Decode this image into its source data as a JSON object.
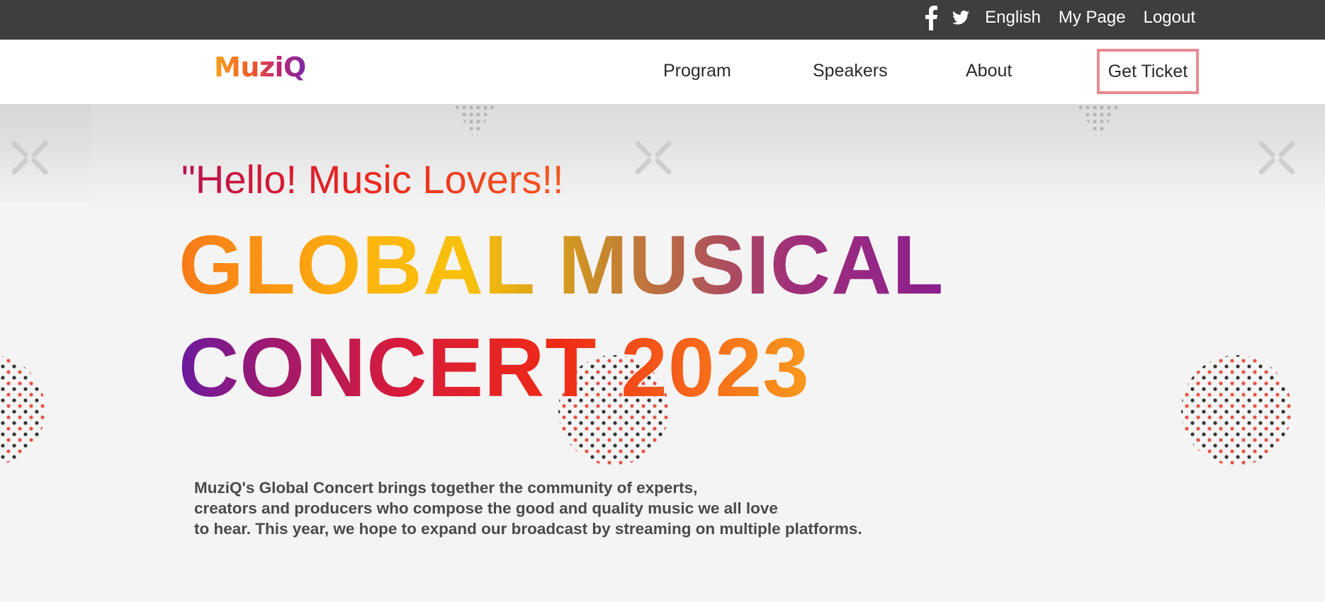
{
  "topbar": {
    "social": [
      {
        "icon": "facebook-icon"
      },
      {
        "icon": "twitter-icon"
      }
    ],
    "language": "English",
    "my_page": "My Page",
    "logout": "Logout",
    "background": "#3e3e3e"
  },
  "navbar": {
    "logo": "MuziQ",
    "links": [
      "Program",
      "Speakers",
      "About"
    ],
    "cta": "Get Ticket",
    "cta_border_color": "#e98a92"
  },
  "hero": {
    "tagline": "\"Hello! Music Lovers!!",
    "headline_line1": "GLOBAL MUSICAL",
    "headline_line2": "CONCERT 2023",
    "description": [
      "MuziQ's Global Concert brings together the community of experts,",
      "creators and producers who compose the good and quality music we all love",
      "to hear. This year, we hope to expand our broadcast by streaming on multiple platforms."
    ]
  }
}
